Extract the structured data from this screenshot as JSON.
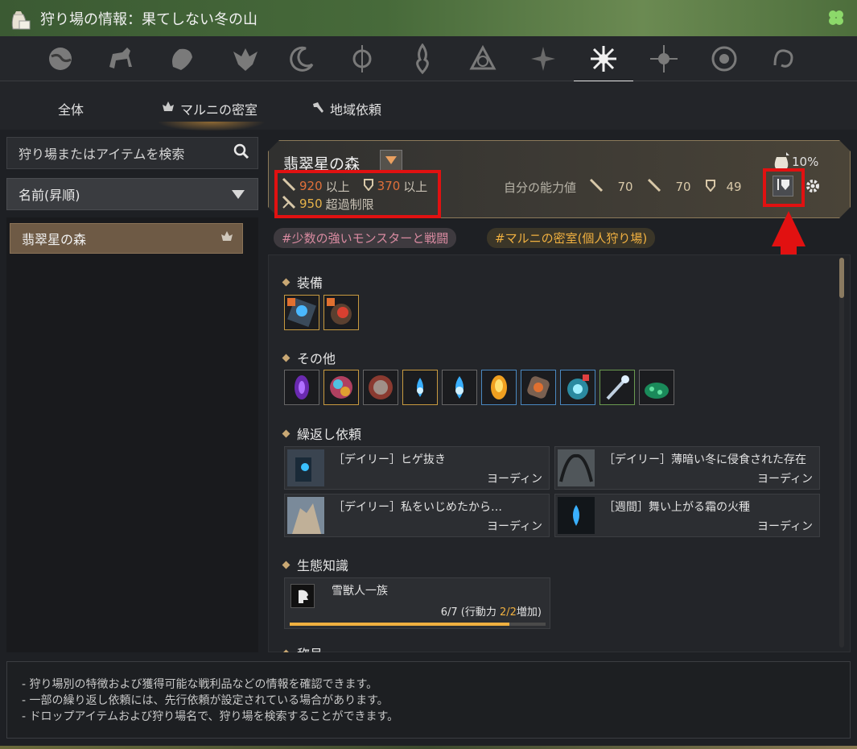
{
  "window": {
    "title": "狩り場の情報：果てしない冬の山",
    "bag_icon": "bag-icon",
    "clover_icon": "clover-icon"
  },
  "region_icons": [
    "globe-icon",
    "horse-icon",
    "lion-icon",
    "eagle-crest-icon",
    "crescent-icon",
    "compass-icon",
    "flame-crest-icon",
    "triquetra-icon",
    "star-crest-icon",
    "snowflake-icon",
    "sun-icon",
    "rune-circle-icon",
    "swirl-icon"
  ],
  "active_region_index": 9,
  "tabs": [
    {
      "label": "全体"
    },
    {
      "label": "マルニの密室",
      "icon": "marni-icon",
      "active": true
    },
    {
      "label": "地域依頼",
      "icon": "hammer-icon"
    }
  ],
  "search": {
    "placeholder": "狩り場またはアイテムを検索"
  },
  "sort": {
    "value": "名前(昇順)"
  },
  "list": [
    {
      "label": "翡翠星の森",
      "icon": "marni-icon"
    }
  ],
  "zone": {
    "name": "翡翠星の森",
    "ap_req": "920",
    "ap_suffix": "以上",
    "dp_req": "370",
    "dp_suffix": "以上",
    "limit": "950",
    "limit_suffix": "超過制限",
    "loot_bonus": "10%",
    "ability_label": "自分の能力値",
    "ability_values": [
      "70",
      "70",
      "49"
    ]
  },
  "hashtags": [
    "#少数の強いモンスターと戦闘",
    "#マルニの密室(個人狩り場)"
  ],
  "sections": {
    "equipment": "装備",
    "other": "その他",
    "repeat_quests": "繰返し依頼",
    "ecology": "生態知識",
    "cut_off": "称号"
  },
  "quests": [
    {
      "title": "［デイリー］ヒゲ抜き",
      "npc": "ヨーディン"
    },
    {
      "title": "［デイリー］薄暗い冬に侵食された存在",
      "npc": "ヨーディン"
    },
    {
      "title": "［デイリー］私をいじめたから…",
      "npc": "ヨーディン"
    },
    {
      "title": "［週間］舞い上がる霜の火種",
      "npc": "ヨーディン"
    }
  ],
  "knowledge": {
    "name": "雪獣人一族",
    "progress_prefix": "6/7 (行動力 ",
    "progress_hl": "2/2",
    "progress_suffix": "増加)",
    "fraction": 0.857
  },
  "footer": [
    "- 狩り場別の特徴および獲得可能な戦利品などの情報を確認できます。",
    "- 一部の繰り返し依頼には、先行依頼が設定されている場合があります。",
    "- ドロップアイテムおよび狩り場名で、狩り場を検索することができます。"
  ],
  "colors": {
    "accent": "#f0b040",
    "highlight_box": "#e11111",
    "ap_red": "#e0703a"
  }
}
